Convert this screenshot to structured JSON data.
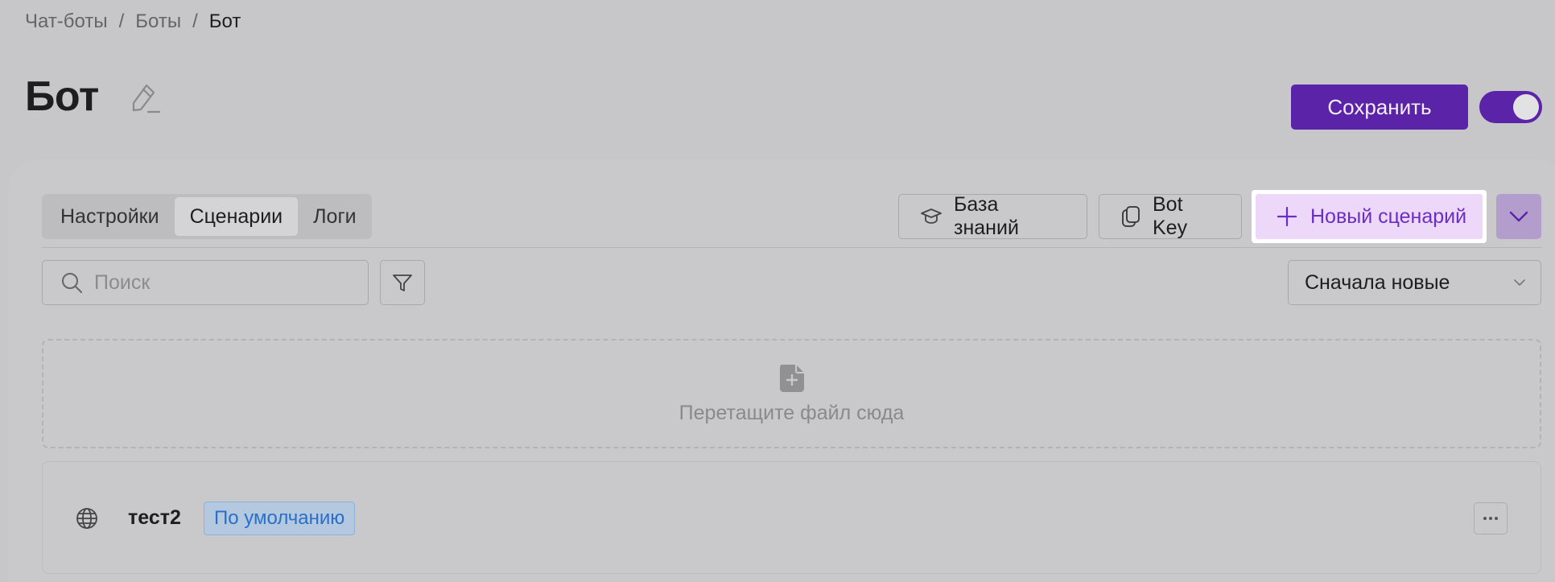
{
  "breadcrumb": {
    "items": [
      "Чат-боты",
      "Боты",
      "Бот"
    ],
    "separator": "/"
  },
  "page": {
    "title": "Бот"
  },
  "header": {
    "save_label": "Сохранить",
    "toggle_on": true
  },
  "tabs": [
    {
      "label": "Настройки",
      "active": false
    },
    {
      "label": "Сценарии",
      "active": true
    },
    {
      "label": "Логи",
      "active": false
    }
  ],
  "toolbar": {
    "knowledge_base_label": "База знаний",
    "knowledge_base_icon": "graduation-cap-icon",
    "bot_key_label": "Bot Key",
    "bot_key_icon": "copy-icon",
    "new_scenario_label": "Новый сценарий",
    "new_scenario_icon": "plus-icon"
  },
  "search": {
    "placeholder": "Поиск",
    "value": ""
  },
  "sort": {
    "selected": "Сначала новые"
  },
  "dropzone": {
    "label": "Перетащите файл сюда",
    "icon": "file-add-icon"
  },
  "scenarios": [
    {
      "name": "тест2",
      "badge": "По умолчанию",
      "icon": "globe-icon"
    }
  ],
  "colors": {
    "accent": "#5b24a8",
    "new_button_bg": "#eed8fa",
    "new_button_text": "#6a2fc2",
    "badge_text": "#2a6fc8"
  }
}
